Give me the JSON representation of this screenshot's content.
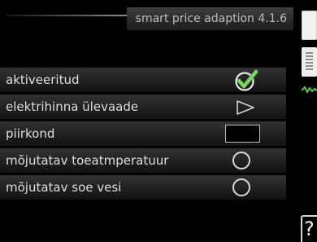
{
  "header": {
    "title": "smart price adaption 4.1.6"
  },
  "menu": {
    "items": [
      {
        "label": "aktiveeritud",
        "control": "checkbox",
        "checked": true
      },
      {
        "label": "elektrihinna ülevaade",
        "control": "arrow"
      },
      {
        "label": "piirkond",
        "control": "field",
        "value": ""
      },
      {
        "label": "mõjutatav toeatmperatuur",
        "control": "radio",
        "checked": false
      },
      {
        "label": "mõjutatav soe vesi",
        "control": "radio",
        "checked": false
      }
    ]
  },
  "sidebar": {
    "help_label": "?"
  },
  "colors": {
    "background": "#000000",
    "accent_green": "#4fbf4c",
    "text": "#dedede"
  },
  "icons": {
    "checkmark": "check-icon",
    "arrow": "chevron-right-icon",
    "help": "help-icon",
    "graph_tab": "graph-wave-icon"
  }
}
